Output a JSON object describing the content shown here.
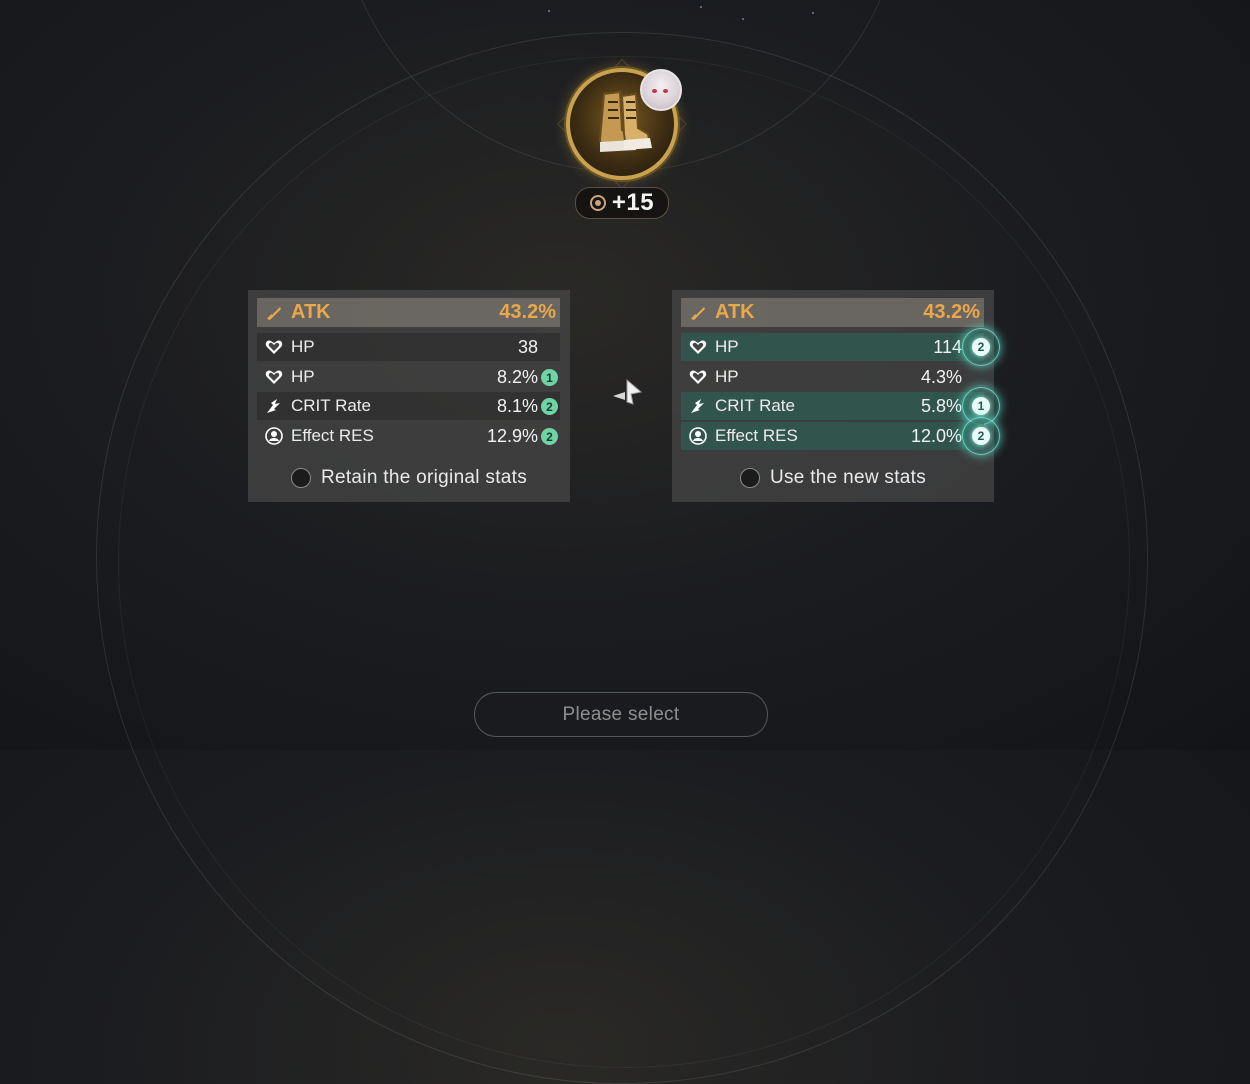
{
  "relic": {
    "name": "boots-relic",
    "level_label": "+15",
    "accent_color": "#c9a24f"
  },
  "panels": {
    "original": {
      "main_stat": {
        "name": "ATK",
        "value": "43.2%",
        "icon": "sword-icon"
      },
      "substats": [
        {
          "name": "HP",
          "value": "38",
          "icon": "heart-icon",
          "rolls": ""
        },
        {
          "name": "HP",
          "value": "8.2%",
          "icon": "heart-icon",
          "rolls": "1"
        },
        {
          "name": "CRIT Rate",
          "value": "8.1%",
          "icon": "crit-icon",
          "rolls": "2"
        },
        {
          "name": "Effect RES",
          "value": "12.9%",
          "icon": "effect-res-icon",
          "rolls": "2"
        }
      ],
      "choice_label": "Retain the original stats"
    },
    "new": {
      "main_stat": {
        "name": "ATK",
        "value": "43.2%",
        "icon": "sword-icon"
      },
      "substats": [
        {
          "name": "HP",
          "value": "114",
          "icon": "heart-icon",
          "rolls": "2",
          "highlight": true
        },
        {
          "name": "HP",
          "value": "4.3%",
          "icon": "heart-icon",
          "rolls": "",
          "highlight": false
        },
        {
          "name": "CRIT Rate",
          "value": "5.8%",
          "icon": "crit-icon",
          "rolls": "1",
          "highlight": true
        },
        {
          "name": "Effect RES",
          "value": "12.0%",
          "icon": "effect-res-icon",
          "rolls": "2",
          "highlight": true
        }
      ],
      "choice_label": "Use the new stats"
    }
  },
  "confirm_button": {
    "label": "Please select"
  },
  "colors": {
    "main_stat": "#e9a84c",
    "roll_badge": "#6fd3a6",
    "highlight_row": "#2e5c52",
    "glow": "#78f0dc"
  }
}
